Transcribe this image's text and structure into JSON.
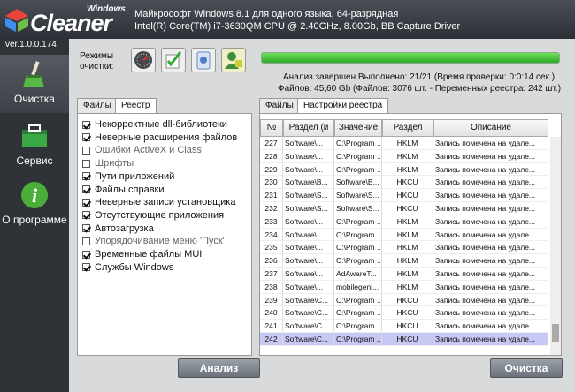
{
  "app": {
    "logo_top": "Windows",
    "logo_main": "Cleaner",
    "version": "ver.1.0.0.174",
    "sysinfo_line1": "Майкрософт Windows 8.1 для одного языка, 64-разрядная",
    "sysinfo_line2": "Intel(R) Core(TM) i7-3630QM CPU @ 2.40GHz, 8.00Gb, BB Capture Driver"
  },
  "sidebar": {
    "items": [
      {
        "label": "Очистка",
        "icon": "broom-icon"
      },
      {
        "label": "Сервис",
        "icon": "toolbox-icon"
      },
      {
        "label": "О программе",
        "icon": "info-icon"
      }
    ]
  },
  "modes": {
    "label_line1": "Режимы",
    "label_line2": "очистки:",
    "icons": [
      "gauge-icon",
      "checklist-icon",
      "registry-icon",
      "user-icon"
    ]
  },
  "status": {
    "progress": 1.0,
    "line1": "Анализ завершен Выполнено: 21/21 (Время проверки: 0:0:14 сек.)",
    "line2": "Файлов: 45,60 Gb (Файлов: 3076 шт. - Переменных реестра: 242 шт.)"
  },
  "left_tabs": [
    "Файлы",
    "Реестр"
  ],
  "registry_items": [
    {
      "label": "Некорректные dll-библиотеки",
      "checked": true
    },
    {
      "label": "Неверные расширения файлов",
      "checked": true
    },
    {
      "label": "Ошибки ActiveX и Class",
      "checked": false
    },
    {
      "label": "Шрифты",
      "checked": false
    },
    {
      "label": "Пути приложений",
      "checked": true
    },
    {
      "label": "Файлы справки",
      "checked": true
    },
    {
      "label": "Неверные записи установщика",
      "checked": true
    },
    {
      "label": "Отсутствующие приложения",
      "checked": true
    },
    {
      "label": "Автозагрузка",
      "checked": true
    },
    {
      "label": "Упорядочивание меню 'Пуск'",
      "checked": false
    },
    {
      "label": "Временные файлы MUI",
      "checked": true
    },
    {
      "label": "Службы Windows",
      "checked": true
    }
  ],
  "analyze_label": "Анализ",
  "clean_label": "Очистка",
  "right_tabs": [
    "Файлы",
    "Настройки реестра"
  ],
  "table": {
    "headers": [
      "№",
      "Раздел (и",
      "Значение",
      "Раздел",
      "Описание"
    ],
    "rows": [
      [
        "227",
        "Software\\...",
        "C:\\Program ...",
        "HKLM",
        "Запись помечена на удале..."
      ],
      [
        "228",
        "Software\\...",
        "C:\\Program ...",
        "HKLM",
        "Запись помечена на удале..."
      ],
      [
        "229",
        "Software\\...",
        "C:\\Program ...",
        "HKLM",
        "Запись помечена на удале..."
      ],
      [
        "230",
        "Software\\B...",
        "Software\\B...",
        "HKCU",
        "Запись помечена на удале..."
      ],
      [
        "231",
        "Software\\S...",
        "Software\\S...",
        "HKCU",
        "Запись помечена на удале..."
      ],
      [
        "232",
        "Software\\S...",
        "Software\\S...",
        "HKCU",
        "Запись помечена на удале..."
      ],
      [
        "233",
        "Software\\...",
        "C:\\Program ...",
        "HKLM",
        "Запись помечена на удале..."
      ],
      [
        "234",
        "Software\\...",
        "C:\\Program ...",
        "HKLM",
        "Запись помечена на удале..."
      ],
      [
        "235",
        "Software\\...",
        "C:\\Program ...",
        "HKLM",
        "Запись помечена на удале..."
      ],
      [
        "236",
        "Software\\...",
        "C:\\Program ...",
        "HKLM",
        "Запись помечена на удале..."
      ],
      [
        "237",
        "Software\\...",
        "AdAwareT...",
        "HKLM",
        "Запись помечена на удале..."
      ],
      [
        "238",
        "Software\\...",
        "mobilegeni...",
        "HKLM",
        "Запись помечена на удале..."
      ],
      [
        "239",
        "Software\\C...",
        "C:\\Program ...",
        "HKCU",
        "Запись помечена на удале..."
      ],
      [
        "240",
        "Software\\C...",
        "C:\\Program ...",
        "HKCU",
        "Запись помечена на удале..."
      ],
      [
        "241",
        "Software\\C...",
        "C:\\Program ...",
        "HKCU",
        "Запись помечена на удале..."
      ],
      [
        "242",
        "Software\\C...",
        "C:\\Program ...",
        "HKCU",
        "Запись помечена на удале..."
      ]
    ],
    "selected_row": 15
  },
  "colors": {
    "progress": "#3cbf35",
    "selection": "#c8c8f4",
    "chrome": "#2f3338"
  }
}
